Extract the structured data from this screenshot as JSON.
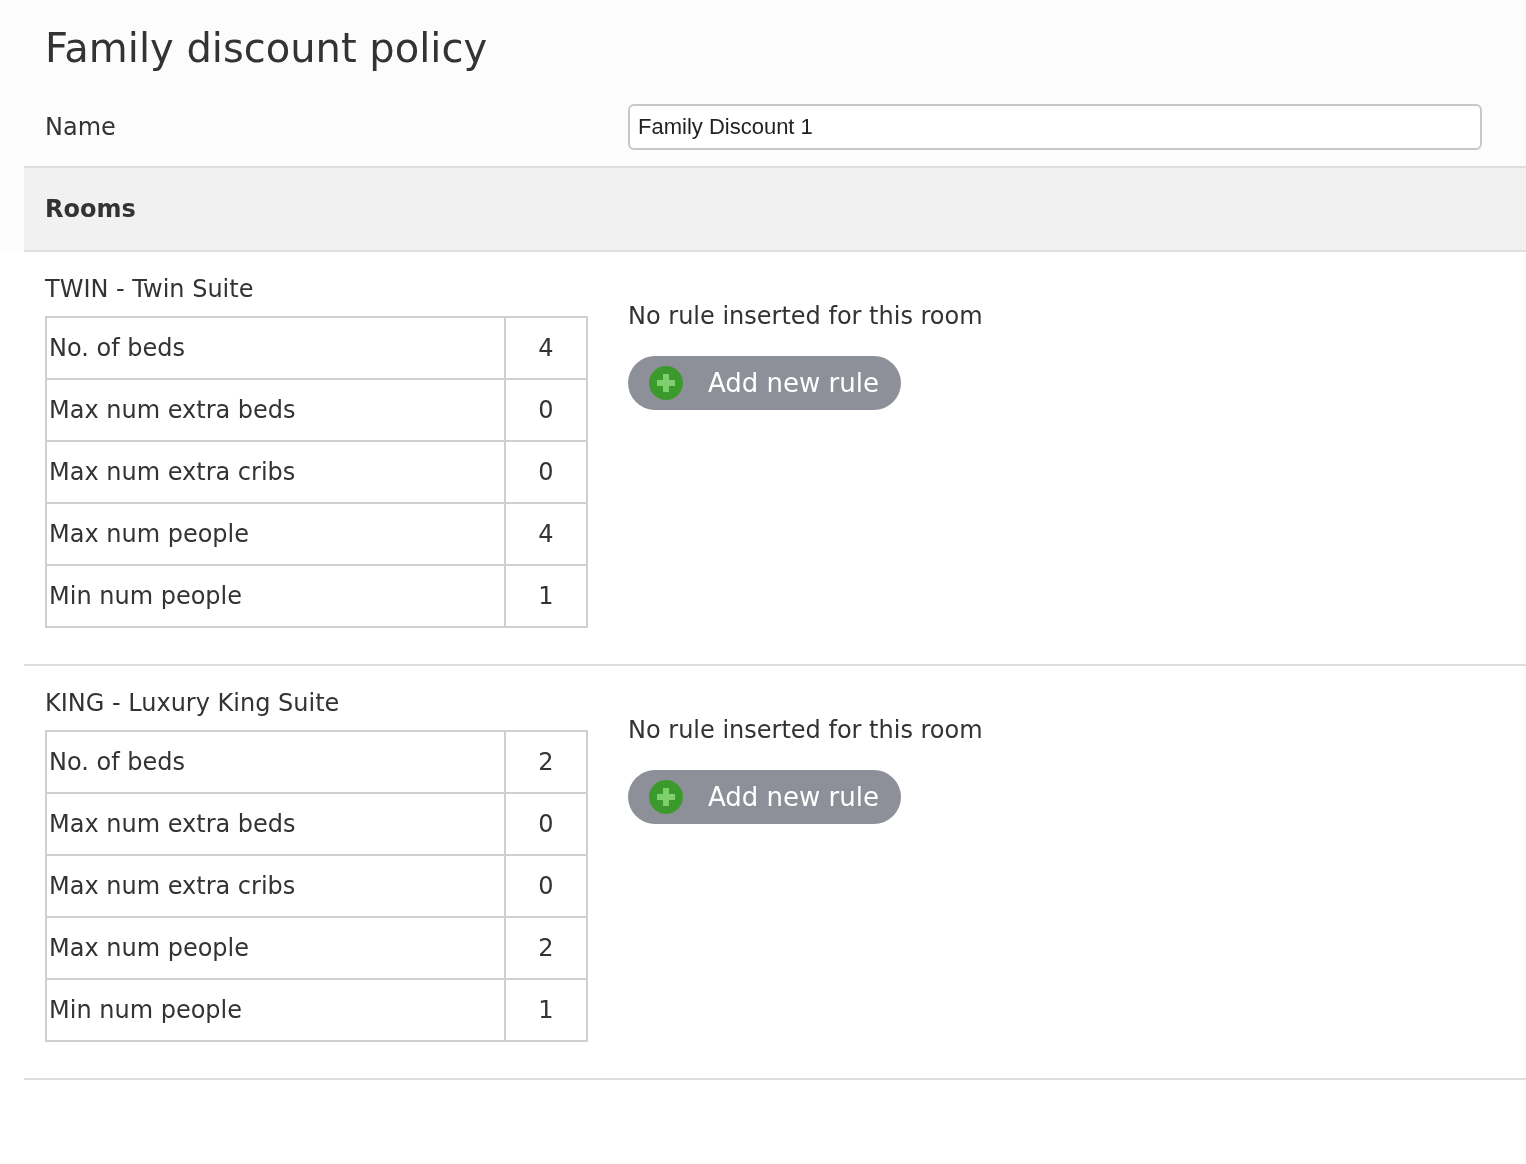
{
  "title": "Family discount policy",
  "name_field": {
    "label": "Name",
    "value": "Family Discount 1"
  },
  "section_header": "Rooms",
  "rooms": [
    {
      "title": "TWIN - Twin Suite",
      "specs": [
        {
          "label": "No. of beds",
          "value": "4"
        },
        {
          "label": "Max num extra beds",
          "value": "0"
        },
        {
          "label": "Max num extra cribs",
          "value": "0"
        },
        {
          "label": "Max num people",
          "value": "4"
        },
        {
          "label": "Min num people",
          "value": "1"
        }
      ],
      "rules_message": "No rule inserted for this room",
      "add_button": "Add new rule"
    },
    {
      "title": "KING - Luxury King Suite",
      "specs": [
        {
          "label": "No. of beds",
          "value": "2"
        },
        {
          "label": "Max num extra beds",
          "value": "0"
        },
        {
          "label": "Max num extra cribs",
          "value": "0"
        },
        {
          "label": "Max num people",
          "value": "2"
        },
        {
          "label": "Min num people",
          "value": "1"
        }
      ],
      "rules_message": "No rule inserted for this room",
      "add_button": "Add new rule"
    }
  ]
}
